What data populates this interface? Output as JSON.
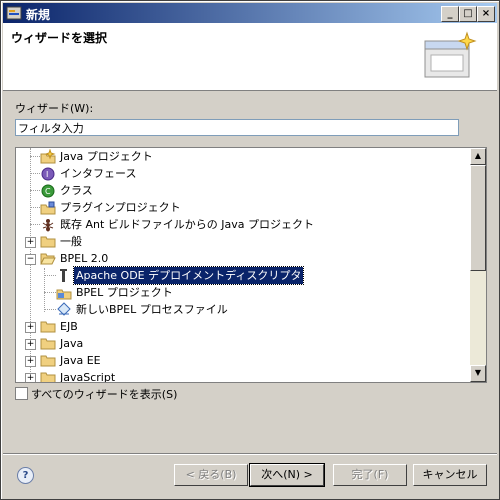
{
  "window": {
    "title": "新規"
  },
  "header": {
    "title": "ウィザードを選択"
  },
  "wizard_label": "ウィザード(W):",
  "filter": {
    "value": "フィルタ入力"
  },
  "tree": {
    "items": [
      {
        "label": "Java プロジェクト",
        "icon": "java-project-icon"
      },
      {
        "label": "インタフェース",
        "icon": "interface-icon"
      },
      {
        "label": "クラス",
        "icon": "class-icon"
      },
      {
        "label": "プラグインプロジェクト",
        "icon": "plugin-project-icon"
      },
      {
        "label": "既存 Ant ビルドファイルからの Java プロジェクト",
        "icon": "ant-icon"
      },
      {
        "label": "一般",
        "icon": "folder-icon"
      },
      {
        "label": "BPEL 2.0",
        "icon": "folder-open-icon"
      },
      {
        "label": "Apache ODE デプロイメントディスクリプタ",
        "icon": "deploy-descriptor-icon"
      },
      {
        "label": "BPEL プロジェクト",
        "icon": "bpel-project-icon"
      },
      {
        "label": "新しいBPEL プロセスファイル",
        "icon": "bpel-process-icon"
      },
      {
        "label": "EJB",
        "icon": "folder-icon"
      },
      {
        "label": "Java",
        "icon": "folder-icon"
      },
      {
        "label": "Java EE",
        "icon": "folder-icon"
      },
      {
        "label": "JavaScript",
        "icon": "folder-icon"
      }
    ]
  },
  "show_all": {
    "label": "すべてのウィザードを表示(S)",
    "checked": false
  },
  "buttons": {
    "back": "< 戻る(B)",
    "next": "次へ(N) >",
    "finish": "完了(F)",
    "cancel": "キャンセル"
  },
  "colors": {
    "selection": "#0a246a",
    "titlebar": "#0a246a"
  }
}
